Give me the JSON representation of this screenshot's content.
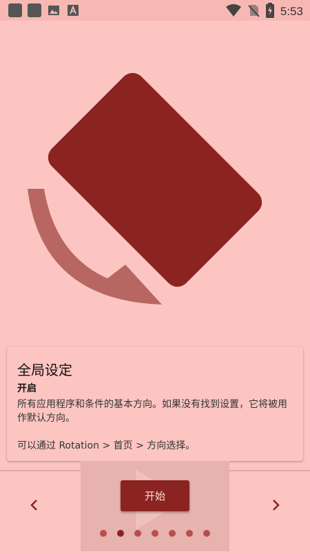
{
  "status_bar": {
    "time": "5:53",
    "left_icons": [
      "app-square-icon",
      "app-square-icon",
      "image-icon",
      "font-icon"
    ],
    "right_icons": [
      "wifi-icon",
      "no-sim-icon",
      "battery-charging-icon"
    ]
  },
  "card": {
    "title": "全局设定",
    "subtitle": "开启",
    "description": "所有应用程序和条件的基本方向。如果没有找到设置，它将被用作默认方向。",
    "hint": "可以通过 Rotation > 首页 > 方向选择。"
  },
  "footer": {
    "start_label": "开始",
    "prev_icon": "chevron-left-icon",
    "next_icon": "chevron-right-icon",
    "page_count": 7,
    "active_page": 2
  },
  "colors": {
    "background": "#fcc5c1",
    "accent": "#8b2320",
    "accent_light": "#b86661"
  }
}
